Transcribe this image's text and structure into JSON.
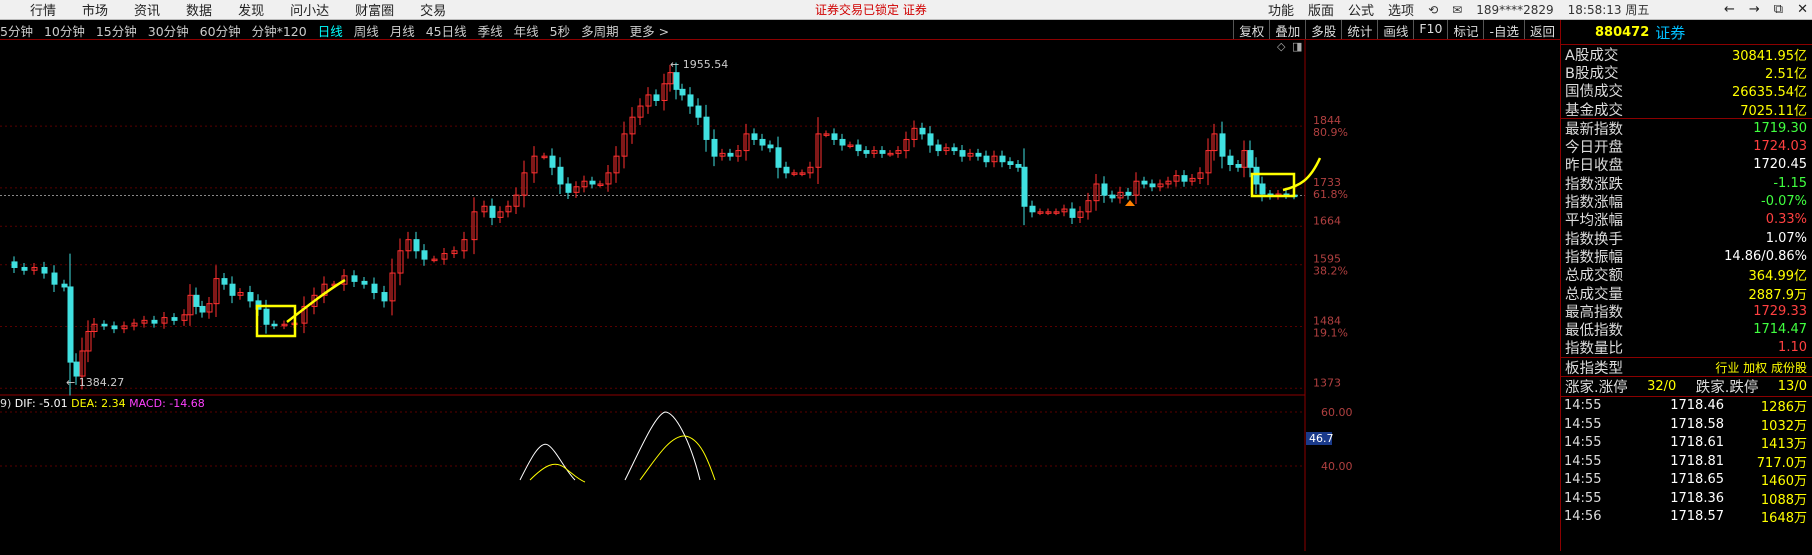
{
  "topbar": {
    "menu": [
      "行情",
      "市场",
      "资讯",
      "数据",
      "发现",
      "问小达",
      "财富圈",
      "交易"
    ],
    "notice": "证券交易已锁定  证券",
    "right_menu": [
      "功能",
      "版面",
      "公式",
      "选项"
    ],
    "account": "189****2829",
    "time": "18:58:13 周五",
    "win_buttons": [
      "←",
      "→",
      "⧉",
      "✕"
    ]
  },
  "periodbar": {
    "periods": [
      "5分钟",
      "10分钟",
      "15分钟",
      "30分钟",
      "60分钟",
      "分钟*120",
      "日线",
      "周线",
      "月线",
      "45日线",
      "季线",
      "年线",
      "5秒",
      "多周期",
      "更多 >"
    ],
    "active": "日线",
    "tools": [
      "复权",
      "叠加",
      "多股",
      "统计",
      "画线",
      "F10",
      "标记",
      "-自选",
      "返回"
    ]
  },
  "chart": {
    "price_axis": [
      "1844",
      "1733",
      "1664",
      "1595",
      "1484",
      "1373"
    ],
    "pct_axis": [
      "80.9%",
      "61.8%",
      "38.2%",
      "19.1%"
    ],
    "high_label": "1955.54",
    "low_label": "1384.27",
    "macd_label": "9)  DIF: -5.01  DEA: 2.34  MACD: -14.68",
    "macd_dif": "DIF: -5.01",
    "macd_dea": "DEA: 2.34",
    "macd_macd": "MACD: -14.68",
    "macd_prefix": "9)",
    "macd_axis": [
      "60.00",
      "46.7",
      "40.00"
    ]
  },
  "chart_data": {
    "type": "candlestick",
    "high": 1955.54,
    "low": 1384.27,
    "last": 1719.3
  },
  "panel": {
    "code": "880472",
    "name": "证券",
    "stats1": [
      {
        "label": "A股成交",
        "value": "30841.95亿",
        "color": "c-y"
      },
      {
        "label": "B股成交",
        "value": "2.51亿",
        "color": "c-y"
      },
      {
        "label": "国债成交",
        "value": "26635.54亿",
        "color": "c-y"
      },
      {
        "label": "基金成交",
        "value": "7025.11亿",
        "color": "c-y"
      }
    ],
    "stats2": [
      {
        "label": "最新指数",
        "value": "1719.30",
        "color": "c-g"
      },
      {
        "label": "今日开盘",
        "value": "1724.03",
        "color": "c-r"
      },
      {
        "label": "昨日收盘",
        "value": "1720.45",
        "color": "c-w"
      },
      {
        "label": "指数涨跌",
        "value": "-1.15",
        "color": "c-g"
      },
      {
        "label": "指数涨幅",
        "value": "-0.07%",
        "color": "c-g"
      },
      {
        "label": "平均涨幅",
        "value": "0.33%",
        "color": "c-r"
      },
      {
        "label": "指数换手",
        "value": "1.07%",
        "color": "c-w"
      },
      {
        "label": "指数振幅",
        "value": "14.86/0.86%",
        "color": "c-w"
      },
      {
        "label": "总成交额",
        "value": "364.99亿",
        "color": "c-y"
      },
      {
        "label": "总成交量",
        "value": "2887.9万",
        "color": "c-y"
      },
      {
        "label": "最高指数",
        "value": "1729.33",
        "color": "c-r"
      },
      {
        "label": "最低指数",
        "value": "1714.47",
        "color": "c-g"
      },
      {
        "label": "指数量比",
        "value": "1.10",
        "color": "c-r"
      }
    ],
    "type_label": "板指类型",
    "type_value": "行业 加权 成份股",
    "updown_label1": "涨家.涨停",
    "updown_value1": "32/0",
    "updown_label2": "跌家.跌停",
    "updown_value2": "13/0",
    "ticks": [
      {
        "t": "14:55",
        "p": "1718.46",
        "v": "1286万"
      },
      {
        "t": "14:55",
        "p": "1718.58",
        "v": "1032万"
      },
      {
        "t": "14:55",
        "p": "1718.61",
        "v": "1413万"
      },
      {
        "t": "14:55",
        "p": "1718.81",
        "v": "717.0万"
      },
      {
        "t": "14:55",
        "p": "1718.65",
        "v": "1460万"
      },
      {
        "t": "14:55",
        "p": "1718.36",
        "v": "1088万"
      },
      {
        "t": "14:56",
        "p": "1718.57",
        "v": "1648万"
      }
    ]
  }
}
